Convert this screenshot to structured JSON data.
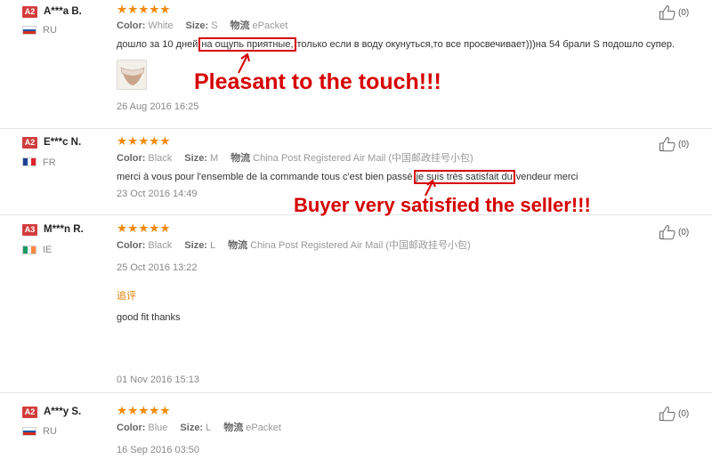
{
  "reviews": [
    {
      "level": "A2",
      "name": "A***a B.",
      "country": "RU",
      "stars": "★★★★★",
      "color_label": "Color:",
      "color": "White",
      "size_label": "Size:",
      "size": "S",
      "shipping_label": "物流",
      "shipping": "ePacket",
      "text_before": "дошло за 10 дней",
      "text_highlight": "на ощупь приятные,",
      "text_after": "только если в воду окунуться,то все просвечивает)))на 54 брали S подошло супер.",
      "date": "26 Aug 2016 16:25",
      "likes": "(0)"
    },
    {
      "level": "A2",
      "name": "E***c N.",
      "country": "FR",
      "stars": "★★★★★",
      "color_label": "Color:",
      "color": "Black",
      "size_label": "Size:",
      "size": "M",
      "shipping_label": "物流",
      "shipping": "China Post Registered Air Mail (中国邮政挂号小包)",
      "text_before": "merci à vous pour l'ensemble de la commande tous c'est bien passé",
      "text_highlight": "je suis très satisfait du",
      "text_after": "vendeur merci",
      "date": "23 Oct 2016 14:49",
      "likes": "(0)"
    },
    {
      "level": "A3",
      "name": "M***n R.",
      "country": "IE",
      "stars": "★★★★★",
      "color_label": "Color:",
      "color": "Black",
      "size_label": "Size:",
      "size": "L",
      "shipping_label": "物流",
      "shipping": "China Post Registered Air Mail (中国邮政挂号小包)",
      "date": "25 Oct 2016 13:22",
      "additional_label": "追评",
      "additional_text": "good fit thanks",
      "additional_date": "01 Nov 2016 15:13",
      "likes": "(0)"
    },
    {
      "level": "A2",
      "name": "A***y S.",
      "country": "RU",
      "stars": "★★★★★",
      "color_label": "Color:",
      "color": "Blue",
      "size_label": "Size:",
      "size": "L",
      "shipping_label": "物流",
      "shipping": "ePacket",
      "date": "16 Sep 2016 03:50",
      "likes": "(0)"
    }
  ],
  "callouts": {
    "first": "Pleasant to the touch!!!",
    "second": "Buyer very satisfied the seller!!!"
  },
  "colors": {
    "badge": "#d23c3c",
    "stars": "#f28a0c",
    "highlight": "#d60000",
    "additional": "#e08000"
  },
  "icons": {
    "like": "thumbs-up-icon",
    "arrow": "arrow-icon"
  }
}
